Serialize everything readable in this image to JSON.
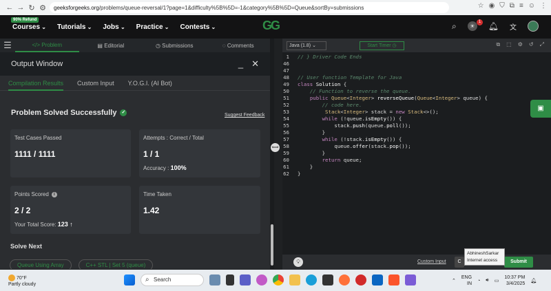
{
  "browser": {
    "url_host": "geeksforgeeks.org",
    "url_rest": "/problems/queue-reversal/1?page=1&difficulty%5B%5D=-1&category%5B%5D=Queue&sortBy=submissions"
  },
  "site": {
    "refund_badge": "90% Refund",
    "logo": "GG",
    "menu": [
      "Courses",
      "Tutorials",
      "Jobs",
      "Practice",
      "Contests"
    ],
    "notification_count": "1"
  },
  "problem_tabs": [
    "Problem",
    "Editorial",
    "Submissions",
    "Comments"
  ],
  "output_window": {
    "title": "Output Window",
    "tabs": [
      "Compilation Results",
      "Custom Input",
      "Y.O.G.I. (AI Bot)"
    ],
    "status": "Problem Solved Successfully",
    "suggest_feedback": "Suggest Feedback",
    "cards": {
      "test_cases": {
        "label": "Test Cases Passed",
        "value": "1111 / 1111"
      },
      "attempts": {
        "label": "Attempts : Correct / Total",
        "value": "1 / 1",
        "sub_label": "Accuracy :",
        "sub_value": "100%"
      },
      "points": {
        "label": "Points Scored",
        "value": "2 / 2",
        "sub_label": "Your Total Score:",
        "sub_value": "123 ↑"
      },
      "time": {
        "label": "Time Taken",
        "value": "1.42"
      }
    },
    "solve_next": "Solve Next",
    "next_problems": [
      "Queue Using Array",
      "C++ STL | Set 5 (queue)"
    ]
  },
  "editor": {
    "language": "Java (1.8)",
    "timer": "Start Timer",
    "lines": [
      {
        "n": "1",
        "html": "<span class='cm'>// } Driver Code Ends</span>"
      },
      {
        "n": "46",
        "html": ""
      },
      {
        "n": "47",
        "html": ""
      },
      {
        "n": "48",
        "html": "<span class='cm'>// User function Template for Java</span>"
      },
      {
        "n": "49",
        "html": "<span class='kw'>class</span> <span class='fn'>Solution</span> {"
      },
      {
        "n": "50",
        "html": "    <span class='cm'>// Function to reverse the queue.</span>"
      },
      {
        "n": "51",
        "html": "    <span class='kw'>public</span> <span class='ty'>Queue</span>&lt;<span class='ty'>Integer</span>&gt; <span class='fn'>reverseQueue</span>(<span class='ty'>Queue</span>&lt;<span class='ty'>Integer</span>&gt; queue) {"
      },
      {
        "n": "52",
        "html": "        <span class='cm'>// code here.</span>"
      },
      {
        "n": "53",
        "html": "         <span class='ty'>Stack</span>&lt;<span class='ty'>Integer</span>&gt; stack = <span class='kw'>new</span> <span class='ty'>Stack</span>&lt;&gt;();"
      },
      {
        "n": "54",
        "html": "        <span class='kw'>while</span> (!queue.<span class='fn'>isEmpty</span>()) {"
      },
      {
        "n": "55",
        "html": "            stack.<span class='fn'>push</span>(queue.<span class='fn'>poll</span>());"
      },
      {
        "n": "56",
        "html": "        }"
      },
      {
        "n": "57",
        "html": "        <span class='kw'>while</span> (!stack.<span class='fn'>isEmpty</span>()) {"
      },
      {
        "n": "58",
        "html": "            queue.<span class='fn'>offer</span>(stack.<span class='fn'>pop</span>());"
      },
      {
        "n": "59",
        "html": "        }"
      },
      {
        "n": "60",
        "html": "        <span class='kw'>return</span> queue;"
      },
      {
        "n": "61",
        "html": "    }"
      },
      {
        "n": "62",
        "html": "}"
      }
    ],
    "custom_input": "Custom Input",
    "compile": "C",
    "submit": "Submit",
    "tooltip_line1": "AbhineshSarkar",
    "tooltip_line2": "Internet access"
  },
  "taskbar": {
    "temp": "70°F",
    "weather": "Partly cloudy",
    "search": "Search",
    "lang_top": "ENG",
    "lang_bottom": "IN",
    "time": "10:37 PM",
    "date": "3/4/2025"
  }
}
